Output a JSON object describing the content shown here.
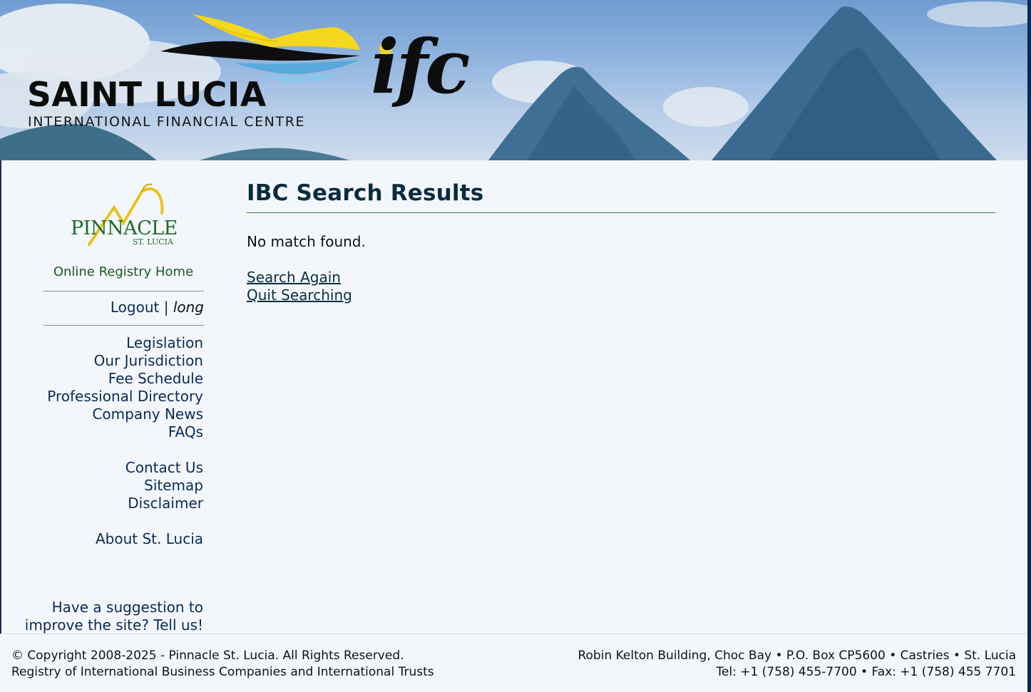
{
  "header": {
    "logo_title": "SAINT LUCIA",
    "logo_subtitle": "INTERNATIONAL FINANCIAL CENTRE",
    "logo_mark": "ifc"
  },
  "sidebar": {
    "brand_name": "PINNACLE",
    "brand_sub": "ST. LUCIA",
    "home_link": "Online Registry Home",
    "logout_label": "Logout",
    "separator": "|",
    "username": "long",
    "nav_group1": [
      "Legislation",
      "Our Jurisdiction",
      "Fee Schedule",
      "Professional Directory",
      "Company News",
      "FAQs"
    ],
    "nav_group2": [
      "Contact Us",
      "Sitemap",
      "Disclaimer"
    ],
    "nav_group3": [
      "About St. Lucia"
    ],
    "suggestion_line1": "Have a suggestion to",
    "suggestion_line2": "improve the site? Tell us!"
  },
  "main": {
    "title": "IBC Search Results",
    "message": "No match found.",
    "search_again": "Search Again",
    "quit_searching": "Quit Searching"
  },
  "footer": {
    "copyright": "© Copyright 2008-2025 - Pinnacle St. Lucia. All Rights Reserved.",
    "registry": "Registry of International Business Companies and International Trusts",
    "address": "Robin Kelton Building, Choc Bay • P.O. Box CP5600 • Castries • St. Lucia",
    "contact": "Tel: +1 (758) 455-7700 • Fax: +1 (758) 455 7701"
  },
  "colors": {
    "navy": "#0a2a55",
    "green": "#1b5a20",
    "background": "#f3f7fc"
  }
}
